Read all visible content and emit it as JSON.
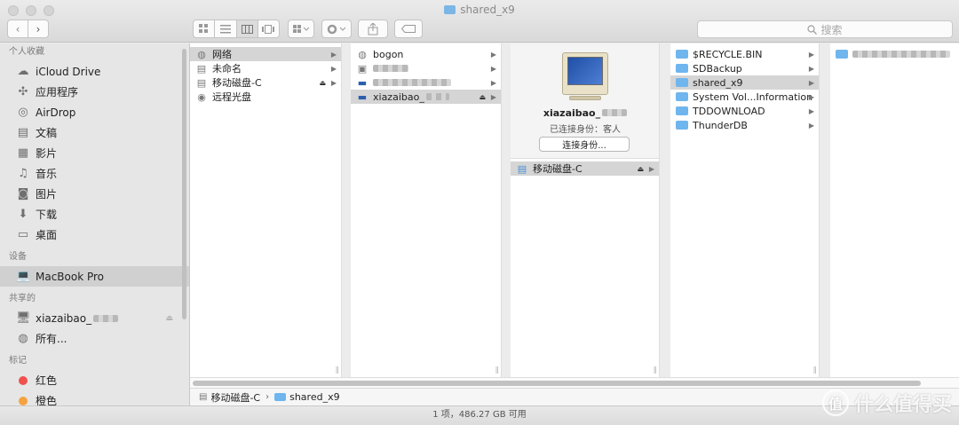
{
  "window": {
    "title": "shared_x9"
  },
  "toolbar": {
    "back_icon": "‹",
    "forward_icon": "›",
    "search_placeholder": "搜索"
  },
  "sidebar": {
    "favorites_header": "个人收藏",
    "favorites": [
      {
        "label": "iCloud Drive",
        "icon": "cloud-icon"
      },
      {
        "label": "应用程序",
        "icon": "applications-icon"
      },
      {
        "label": "AirDrop",
        "icon": "airdrop-icon"
      },
      {
        "label": "文稿",
        "icon": "documents-icon"
      },
      {
        "label": "影片",
        "icon": "movies-icon"
      },
      {
        "label": "音乐",
        "icon": "music-icon"
      },
      {
        "label": "图片",
        "icon": "pictures-icon"
      },
      {
        "label": "下载",
        "icon": "downloads-icon"
      },
      {
        "label": "桌面",
        "icon": "desktop-icon"
      }
    ],
    "devices_header": "设备",
    "devices": [
      {
        "label": "MacBook Pro",
        "icon": "laptop-icon"
      }
    ],
    "shared_header": "共享的",
    "shared": [
      {
        "label": "xiazaibao_",
        "icon": "monitor-icon"
      },
      {
        "label": "所有...",
        "icon": "network-icon"
      }
    ],
    "tags_header": "标记",
    "tags": [
      {
        "label": "红色",
        "color": "#f0514e"
      },
      {
        "label": "橙色",
        "color": "#f5a340"
      }
    ]
  },
  "columns": {
    "col1": [
      {
        "label": "网络",
        "icon": "network-icon"
      },
      {
        "label": "未命名",
        "icon": "drive-icon"
      },
      {
        "label": "移动磁盘-C",
        "icon": "drive-icon"
      },
      {
        "label": "远程光盘",
        "icon": "disc-icon"
      }
    ],
    "col2": [
      {
        "label": "bogon",
        "icon": "network-icon"
      },
      {
        "label": "",
        "icon": "server-icon"
      },
      {
        "label": "",
        "icon": "monitor-icon"
      },
      {
        "label": "xiazaibao_",
        "icon": "monitor-icon"
      }
    ],
    "preview": {
      "name": "xiazaibao_",
      "status": "已连接身份：客人",
      "connect_button": "连接身份...",
      "items": [
        {
          "label": "移动磁盘-C"
        }
      ]
    },
    "col4": [
      {
        "label": "$RECYCLE.BIN"
      },
      {
        "label": "SDBackup"
      },
      {
        "label": "shared_x9"
      },
      {
        "label": "System Vol...Information"
      },
      {
        "label": "TDDOWNLOAD"
      },
      {
        "label": "ThunderDB"
      }
    ]
  },
  "pathbar": {
    "items": [
      {
        "label": "移动磁盘-C",
        "icon": "drive-icon"
      },
      {
        "label": "shared_x9",
        "icon": "folder-icon"
      }
    ],
    "separator": "›"
  },
  "status": {
    "text": "1 项，486.27 GB 可用"
  },
  "watermark": {
    "badge": "值",
    "text": "什么值得买"
  }
}
